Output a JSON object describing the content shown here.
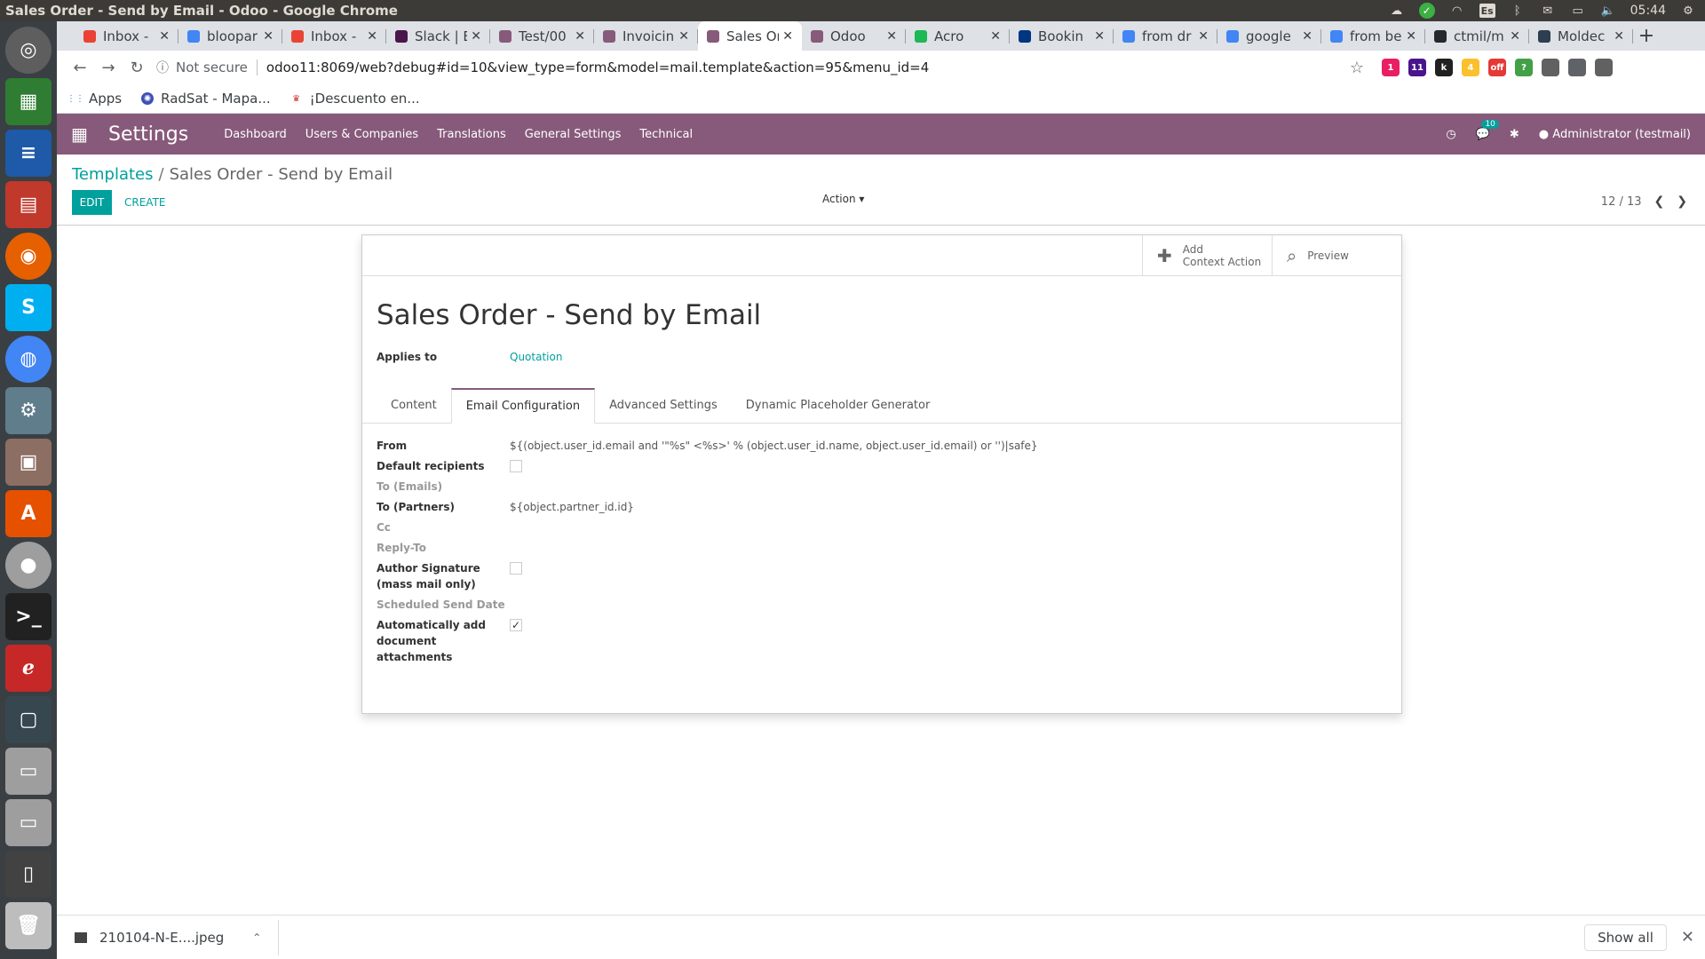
{
  "window_title": "Sales Order - Send by Email - Odoo - Google Chrome",
  "system_tray": {
    "lang": "Es",
    "time": "05:44"
  },
  "tabs": [
    {
      "label": "Inbox - ",
      "color": "#ea4335"
    },
    {
      "label": "bloopar",
      "color": "#4285f4"
    },
    {
      "label": "Inbox - ",
      "color": "#ea4335"
    },
    {
      "label": "Slack | E",
      "color": "#4a154b"
    },
    {
      "label": "Test/00",
      "color": "#875a7b"
    },
    {
      "label": "Invoicin",
      "color": "#875a7b"
    },
    {
      "label": "Sales Or",
      "color": "#875a7b"
    },
    {
      "label": "Odoo",
      "color": "#875a7b"
    },
    {
      "label": "Acro",
      "color": "#1db954"
    },
    {
      "label": "Bookin",
      "color": "#003580"
    },
    {
      "label": "from dr",
      "color": "#4285f4"
    },
    {
      "label": "google",
      "color": "#4285f4"
    },
    {
      "label": "from be",
      "color": "#4285f4"
    },
    {
      "label": "ctmil/m",
      "color": "#24292e"
    },
    {
      "label": "Moldec",
      "color": "#2c3e50"
    }
  ],
  "omnibox": {
    "security": "Not secure",
    "url": "odoo11:8069/web?debug#id=10&view_type=form&model=mail.template&action=95&menu_id=4"
  },
  "extensions": [
    "1",
    "11",
    "k",
    "4",
    "off",
    "?",
    "",
    "",
    ""
  ],
  "bookmarks": [
    {
      "label": "Apps"
    },
    {
      "label": "RadSat - Mapa..."
    },
    {
      "label": "¡Descuento en..."
    }
  ],
  "odoo_nav": {
    "brand": "Settings",
    "menu": [
      "Dashboard",
      "Users & Companies",
      "Translations",
      "General Settings",
      "Technical"
    ],
    "notif_count": "10",
    "user": "Administrator (testmail)"
  },
  "control_panel": {
    "breadcrumb_parent": "Templates",
    "breadcrumb_current": "Sales Order - Send by Email",
    "edit_label": "EDIT",
    "create_label": "CREATE",
    "action_label": "Action",
    "pager": "12 / 13"
  },
  "form": {
    "smart_buttons": [
      {
        "line1": "Add",
        "line2": "Context Action"
      },
      {
        "line1": "Preview",
        "line2": ""
      }
    ],
    "title": "Sales Order - Send by Email",
    "applies_to_label": "Applies to",
    "applies_to_value": "Quotation",
    "tabs": [
      "Content",
      "Email Configuration",
      "Advanced Settings",
      "Dynamic Placeholder Generator"
    ],
    "active_tab": "Email Configuration",
    "fields": {
      "from_label": "From",
      "from_value": "${(object.user_id.email and '\"%s\" <%s>' % (object.user_id.name, object.user_id.email) or '')|safe}",
      "default_recipients_label": "Default recipients",
      "to_emails_label": "To (Emails)",
      "to_partners_label": "To (Partners)",
      "to_partners_value": "${object.partner_id.id}",
      "cc_label": "Cc",
      "reply_to_label": "Reply-To",
      "author_signature_label1": "Author Signature",
      "author_signature_label2": "(mass mail only)",
      "scheduled_label": "Scheduled Send Date",
      "auto_attach_label1": "Automatically add",
      "auto_attach_label2": "document",
      "auto_attach_label3": "attachments"
    }
  },
  "download_bar": {
    "file": "210104-N-E....jpeg",
    "show_all": "Show all"
  }
}
